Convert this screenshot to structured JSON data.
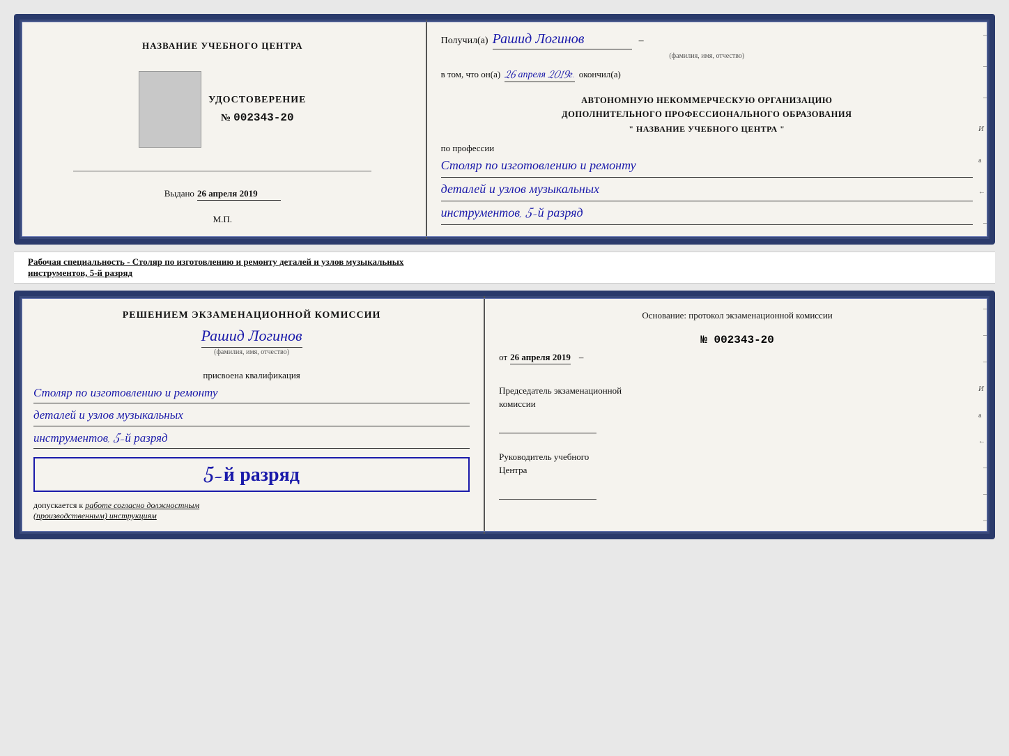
{
  "top_card": {
    "left": {
      "org_title": "НАЗВАНИЕ УЧЕБНОГО ЦЕНТРА",
      "udostoverenie_label": "УДОСТОВЕРЕНИЕ",
      "number_prefix": "№",
      "number": "002343-20",
      "issued_prefix": "Выдано",
      "issued_date": "26 апреля 2019",
      "mp_label": "М.П."
    },
    "right": {
      "received_prefix": "Получил(а)",
      "recipient_name": "Рашид Логинов",
      "fio_label": "(фамилия, имя, отчество)",
      "vtom_prefix": "в том, что он(а)",
      "vtom_date": "26 апреля 2019г.",
      "vtom_suffix": "окончил(а)",
      "org_line1": "АВТОНОМНУЮ НЕКОММЕРЧЕСКУЮ ОРГАНИЗАЦИЮ",
      "org_line2": "ДОПОЛНИТЕЛЬНОГО ПРОФЕССИОНАЛЬНОГО ОБРАЗОВАНИЯ",
      "org_name": "\"  НАЗВАНИЕ УЧЕБНОГО ЦЕНТРА  \"",
      "profession_prefix": "по профессии",
      "profession_line1": "Столяр по изготовлению и ремонту",
      "profession_line2": "деталей и узлов музыкальных",
      "profession_line3": "инструментов, 5-й разряд"
    }
  },
  "middle_label": {
    "prefix": "Рабочая специальность - Столяр по изготовлению и ремонту деталей и узлов музыкальных",
    "underlined": "инструментов, 5-й разряд"
  },
  "bottom_card": {
    "left": {
      "resheniem_title": "Решением экзаменационной комиссии",
      "person_name": "Рашид Логинов",
      "fio_label": "(фамилия, имя, отчество)",
      "assigned_label": "присвоена квалификация",
      "qualification_line1": "Столяр по изготовлению и ремонту",
      "qualification_line2": "деталей и узлов музыкальных",
      "qualification_line3": "инструментов, 5-й разряд",
      "rank_text": "5-й разряд",
      "dopuskaetsya_prefix": "допускается к",
      "dopuskaetsya_italic": "работе согласно должностным",
      "dopuskaetsya_italic2": "(производственным) инструкциям"
    },
    "right": {
      "osnovanie_title": "Основание: протокол экзаменационной комиссии",
      "number_prefix": "№",
      "number": "002343-20",
      "ot_prefix": "от",
      "ot_date": "26 апреля 2019",
      "chairman_title": "Председатель экзаменационной\nкомиссии",
      "director_title": "Руководитель учебного\nЦентра"
    }
  },
  "deco": {
    "side_chars": [
      "И",
      "а",
      "←",
      "–",
      "–",
      "–",
      "–",
      "–"
    ]
  }
}
